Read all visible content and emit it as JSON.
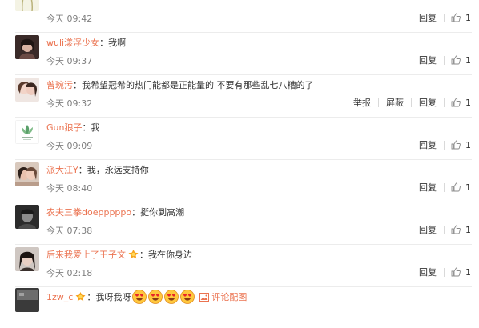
{
  "comments": [
    {
      "user": "",
      "text": "",
      "time": "今天 09:42",
      "reply": "回复",
      "likes": "1"
    },
    {
      "user": "wuli漾浮少女",
      "text": "我啊",
      "time": "今天 09:37",
      "reply": "回复",
      "likes": "1"
    },
    {
      "user": "曾琬污",
      "text": "我希望冠希的热门能都是正能量的 不要有那些乱七八糟的了",
      "time": "今天 09:32",
      "report": "举报",
      "block": "屏蔽",
      "reply": "回复",
      "likes": "1"
    },
    {
      "user": "Gun狼子",
      "text": "我",
      "time": "今天 09:09",
      "reply": "回复",
      "likes": "1"
    },
    {
      "user": "派大江Y",
      "text": "我，永远支持你",
      "time": "今天 08:40",
      "reply": "回复",
      "likes": "1"
    },
    {
      "user": "农夫三拳doepppppo",
      "text": "挺你到高潮",
      "time": "今天 07:38",
      "reply": "回复",
      "likes": "1"
    },
    {
      "user": "后来我爱上了王子文",
      "text": "我在你身边",
      "time": "今天 02:18",
      "reply": "回复",
      "likes": "1"
    },
    {
      "user": "1zw_c",
      "text": "我呀我呀",
      "pic_link": "评论配图"
    }
  ],
  "colors": {
    "username": "#eb7350",
    "time": "#808080",
    "text": "#333333",
    "like_icon": "#8a8a8a"
  },
  "icons": {
    "like": "thumbs-up-icon",
    "vip": "vip-badge-icon",
    "emoji": "heart-eyes-emoji",
    "image": "image-icon"
  }
}
